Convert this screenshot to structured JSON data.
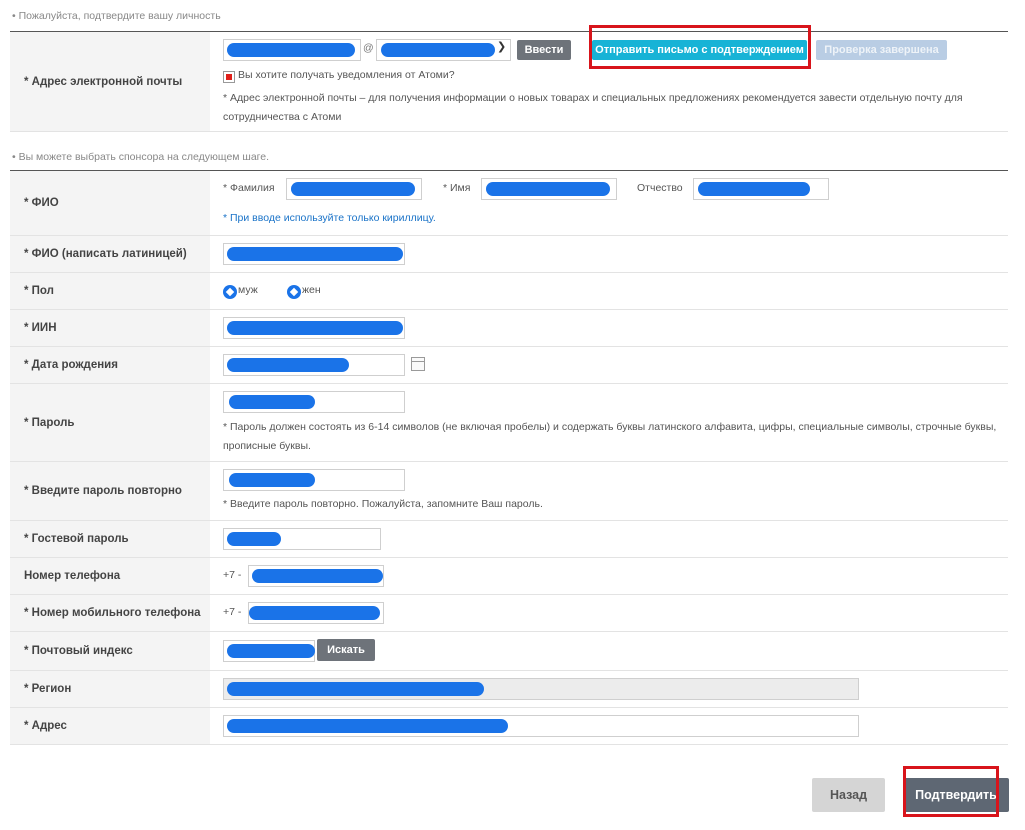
{
  "notes": {
    "identity": "• Пожалуйста, подтвердите вашу личность",
    "sponsor": "• Вы можете выбрать спонсора на следующем шаге."
  },
  "email": {
    "label": "* Адрес электронной почты",
    "at": "@",
    "enter_button": "Ввести",
    "send_button": "Отправить письмо с подтверждением",
    "done_button": "Проверка завершена",
    "subscribe_label": "Вы хотите получать уведомления от Атоми?",
    "hint": "* Адрес электронной почты – для получения информации о новых товарах и специальных предложениях рекомендуется завести отдельную почту для сотрудничества с Атоми"
  },
  "fio": {
    "label": "* ФИО",
    "surname_label": "* Фамилия",
    "name_label": "* Имя",
    "patronymic_label": "Отчество",
    "hint": "* При вводе используйте только кириллицу."
  },
  "fio_latin": {
    "label": "* ФИО (написать латиницей)"
  },
  "gender": {
    "label": "* Пол",
    "male": "муж",
    "female": "жен"
  },
  "iin": {
    "label": "* ИИН"
  },
  "birth": {
    "label": "* Дата рождения"
  },
  "password": {
    "label": "* Пароль",
    "hint": "* Пароль должен состоять из 6-14 символов (не включая пробелы) и содержать буквы латинского алфавита, цифры, специальные символы, строчные буквы, прописные буквы."
  },
  "password_repeat": {
    "label": "* Введите пароль повторно",
    "hint": "* Введите пароль повторно. Пожалуйста, запомните Ваш пароль."
  },
  "guest_password": {
    "label": "* Гостевой пароль"
  },
  "phone": {
    "label": "Номер телефона",
    "prefix": "+7 -"
  },
  "mobile": {
    "label": "* Номер мобильного телефона",
    "prefix": "+7 -"
  },
  "postal": {
    "label": "* Почтовый индекс",
    "search_button": "Искать"
  },
  "region": {
    "label": "* Регион"
  },
  "address": {
    "label": "* Адрес"
  },
  "actions": {
    "back": "Назад",
    "confirm": "Подтвердить"
  },
  "colors": {
    "redaction": "#1a73e8",
    "highlight": "#d8141b",
    "cyan_button": "#17b3d6"
  }
}
